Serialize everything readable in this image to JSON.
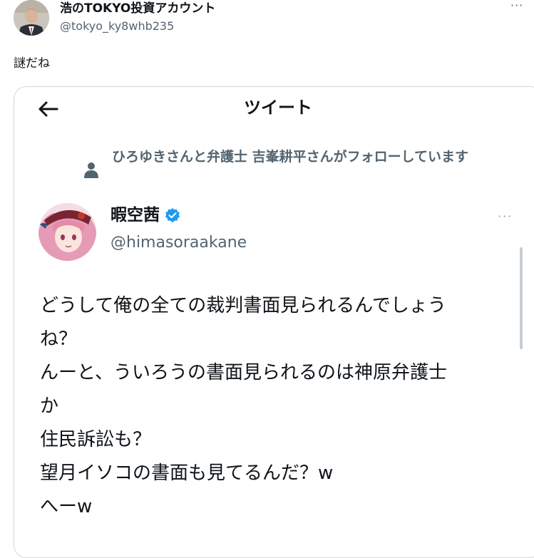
{
  "author": {
    "name": "浩のTOKYO投資アカウント",
    "handle": "@tokyo_ky8whb235"
  },
  "post": {
    "text": "謎だね"
  },
  "quoted_tweet": {
    "header_title": "ツイート",
    "social_context": "ひろゆきさんと弁護士 吉峯耕平さんがフォローしています",
    "author_name": "暇空茜",
    "author_handle": "@himasoraakane",
    "lines": [
      "どうして俺の全ての裁判書面見られるんでしょう",
      "ね？",
      "んーと、ういろうの書面見られるのは神原弁護士",
      "か",
      "住民訴訟も？",
      "望月イソコの書面も見てるんだ？w",
      "へーw"
    ]
  },
  "icons": {
    "back": "arrow-left-icon",
    "more": "ellipsis-icon",
    "person": "person-icon",
    "verified": "verified-badge-icon"
  },
  "colors": {
    "text": "#0f1419",
    "secondary": "#536471",
    "border": "#cfd9de",
    "verified": "#1d9bf0"
  }
}
